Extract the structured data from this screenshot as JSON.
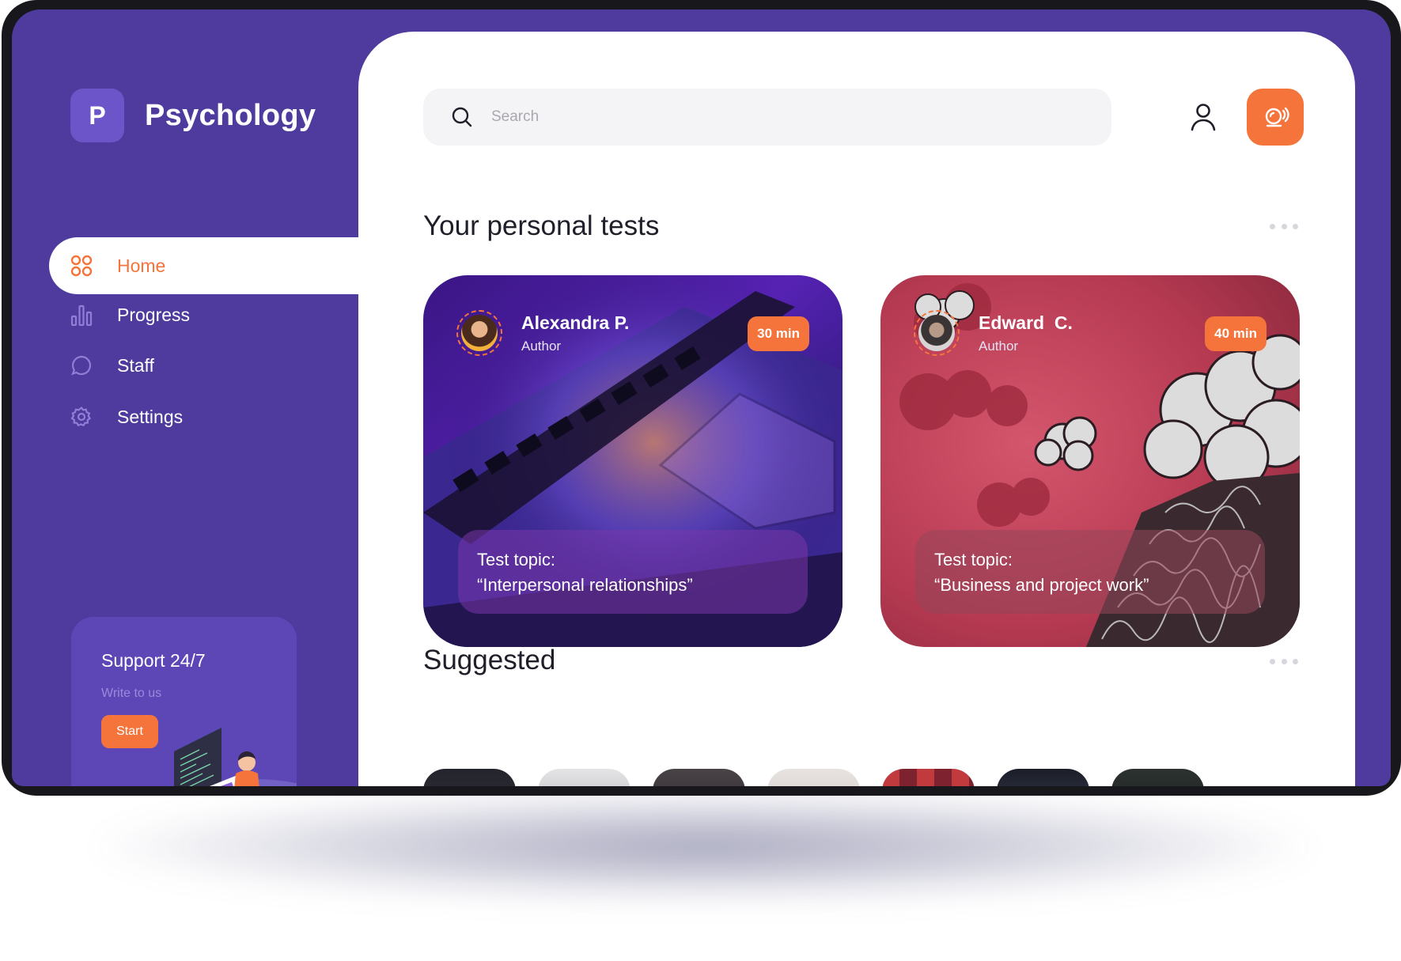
{
  "app": {
    "logo_letter": "P",
    "name": "Psychology"
  },
  "sidebar": {
    "items": [
      {
        "label": "Home",
        "icon": "grid-icon",
        "active": true
      },
      {
        "label": "Progress",
        "icon": "bar-chart-icon",
        "active": false
      },
      {
        "label": "Staff",
        "icon": "chat-bubble-icon",
        "active": false
      },
      {
        "label": "Settings",
        "icon": "gear-icon",
        "active": false
      }
    ],
    "support": {
      "title": "Support 24/7",
      "subtitle": "Write to us",
      "button_label": "Start"
    }
  },
  "header": {
    "search_placeholder": "Search",
    "search_value": "",
    "user_icon": "user-icon",
    "alarm_icon": "alarm-icon"
  },
  "personal_tests": {
    "title": "Your personal tests",
    "cards": [
      {
        "author_name": "Alexandra P.",
        "author_role": "Author",
        "duration": "30 min",
        "topic_line1": "Test topic:",
        "topic_line2": "“Interpersonal relationships”"
      },
      {
        "author_name": "Edward  C.",
        "author_role": "Author",
        "duration": "40 min",
        "topic_line1": "Test topic:",
        "topic_line2": "“Business and project work”"
      }
    ]
  },
  "suggested": {
    "title": "Suggested",
    "thumbnail_count": 7
  },
  "colors": {
    "brand_purple": "#4f3b9e",
    "accent_orange": "#f4743b",
    "sidebar_tile": "#6c55c8",
    "text_dark": "#1f1f2a"
  }
}
